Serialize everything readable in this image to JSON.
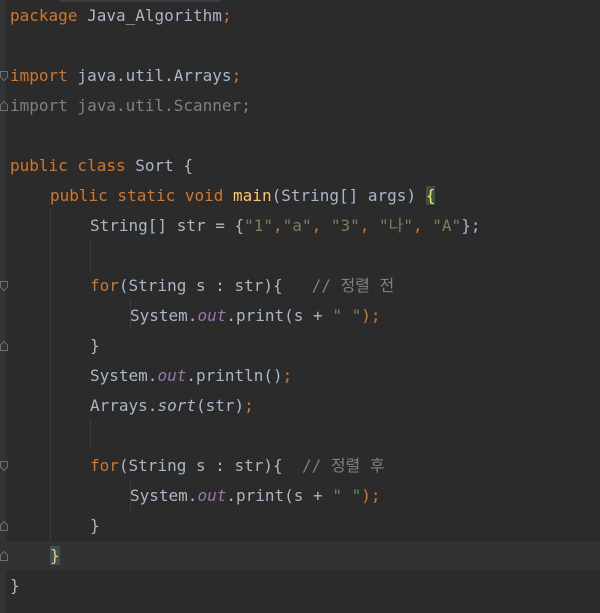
{
  "colors": {
    "background": "#2b2b2b",
    "default_text": "#a9b7c6",
    "keyword": "#cc7832",
    "string": "#6a8759",
    "function": "#ffc66d",
    "static_field": "#9876aa",
    "comment": "#808080",
    "brace_match_bg": "#3b514d",
    "current_line_bg": "#323232"
  },
  "code": {
    "l1": {
      "kw": "package",
      "pkg": " Java_Algorithm",
      "semi": ";"
    },
    "l3": {
      "kw": "import",
      "pkg": " java.util.Arrays",
      "semi": ";"
    },
    "l4": {
      "text": "import java.util.Scanner;"
    },
    "l6": {
      "kw1": "public",
      "kw2": " class",
      "name": " Sort {"
    },
    "l7": {
      "kw1": "public",
      "kw2": " static",
      "kw3": " void",
      "fn": " main",
      "params": "(String[] args) ",
      "brace": "{"
    },
    "l8": {
      "decl": "String[] str = {",
      "s1": "\"1\"",
      "c1": ",",
      "s2": "\"a\"",
      "c2": ", ",
      "s3": "\"3\"",
      "c3": ", ",
      "s4": "\"나\"",
      "c4": ", ",
      "s5": "\"A\"",
      "end": "};"
    },
    "l10": {
      "kw": "for",
      "rest": "(String s : str){   ",
      "comment": "// 정렬 전"
    },
    "l11": {
      "cls": "System.",
      "field": "out",
      "call": ".print(s + ",
      "str": "\" \"",
      "end": ");"
    },
    "l12": {
      "text": "}"
    },
    "l13": {
      "cls": "System.",
      "field": "out",
      "call": ".println()",
      "end": ";"
    },
    "l14": {
      "cls": "Arrays.",
      "method": "sort",
      "call": "(str)",
      "end": ";"
    },
    "l16": {
      "kw": "for",
      "rest": "(String s : str){  ",
      "comment": "// 정렬 후"
    },
    "l17": {
      "cls": "System.",
      "field": "out",
      "call": ".print(s + ",
      "str": "\" \"",
      "end": ");"
    },
    "l18": {
      "text": "}"
    },
    "l19": {
      "brace": "}"
    },
    "l20": {
      "text": "}"
    }
  }
}
